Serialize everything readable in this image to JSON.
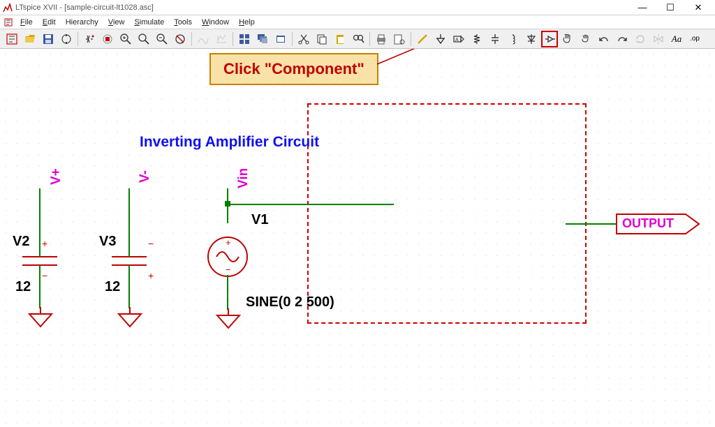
{
  "window": {
    "app_title": "LTspice XVII - [sample-circuit-lt1028.asc]"
  },
  "menu": {
    "file": "File",
    "edit": "Edit",
    "hierarchy": "Hierarchy",
    "view": "View",
    "simulate": "Simulate",
    "tools": "Tools",
    "window": "Window",
    "help": "Help"
  },
  "toolbar_icons": {
    "new": "new-schematic-icon",
    "open": "open-icon",
    "save": "save-icon",
    "setup": "control-panel-icon",
    "run": "run-icon",
    "halt": "halt-icon",
    "pan": "pan-icon",
    "zoomin": "zoom-in-icon",
    "zoomreset": "zoom-pan-icon",
    "zoomout": "zoom-out-icon",
    "autorange": "zoom-fit-icon",
    "errlog": "error-log-icon",
    "tile": "tile-icon",
    "cascade": "cascade-icon",
    "closewin": "close-window-icon",
    "cut": "cut-icon",
    "copy": "copy-icon",
    "paste": "paste-icon",
    "find": "find-icon",
    "print": "print-icon",
    "printsetup": "print-setup-icon",
    "drawwire": "draw-wire-icon",
    "ground": "ground-icon",
    "netname": "label-net-icon",
    "resistor": "resistor-icon",
    "capacitor": "capacitor-icon",
    "inductor": "inductor-icon",
    "diode": "diode-icon",
    "component": "component-icon",
    "move": "move-icon",
    "drag": "drag-icon",
    "undo": "undo-icon",
    "redo": "redo-icon",
    "rotate": "rotate-icon",
    "mirror": "mirror-icon",
    "text": "text-icon",
    "spice": "spice-directive-icon"
  },
  "annotation": {
    "callout": "Click \"Component\""
  },
  "schematic": {
    "title": "Inverting Amplifier Circuit",
    "nets": {
      "vplus": "V+",
      "vminus": "V-",
      "vin": "Vin",
      "output": "OUTPUT"
    },
    "components": {
      "V1": {
        "name": "V1",
        "value": "SINE(0 2 500)"
      },
      "V2": {
        "name": "V2",
        "value": "12"
      },
      "V3": {
        "name": "V3",
        "value": "12"
      }
    }
  }
}
